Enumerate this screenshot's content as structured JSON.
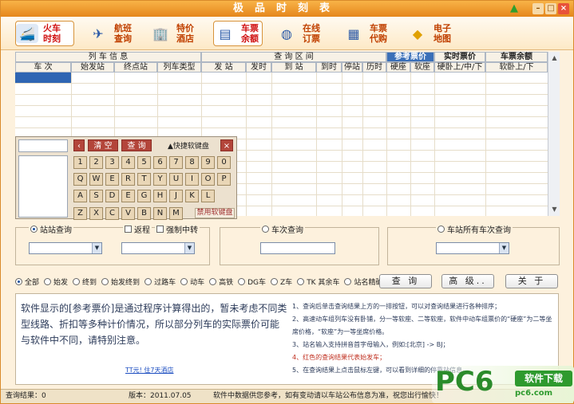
{
  "window": {
    "title": "极品时刻表"
  },
  "toolbar": {
    "items": [
      {
        "label": "火车时刻",
        "icon": "train-icon",
        "active": true
      },
      {
        "label": "航班查询",
        "icon": "airplane-icon",
        "active": false
      },
      {
        "label": "特价酒店",
        "icon": "hotel-icon",
        "active": false
      },
      {
        "label": "车票余额",
        "icon": "ticket-icon",
        "active": true
      },
      {
        "label": "在线订票",
        "icon": "globe-icon",
        "active": false
      },
      {
        "label": "车票代购",
        "icon": "book-icon",
        "active": false
      },
      {
        "label": "电子地图",
        "icon": "map-icon",
        "active": false
      }
    ]
  },
  "table": {
    "group_headers": {
      "train_info": "列 车 信 息",
      "query_interval": "查 询 区 间",
      "ref_price": "参考票价",
      "realtime_price": "实时票价",
      "remaining": "车票余额"
    },
    "columns": [
      "车 次",
      "始发站",
      "终点站",
      "列车类型",
      "发 站",
      "发时",
      "到 站",
      "到时",
      "停站",
      "历时",
      "硬座",
      "软座",
      "硬卧上/中/下",
      "软卧上/下"
    ]
  },
  "keyboard": {
    "clear_label": "清 空",
    "query_label": "查 询",
    "title": "▲快捷软键盘",
    "disable_label": "禁用软键盘",
    "row1": [
      "1",
      "2",
      "3",
      "4",
      "5",
      "6",
      "7",
      "8",
      "9",
      "0"
    ],
    "row2": [
      "Q",
      "W",
      "E",
      "R",
      "T",
      "Y",
      "U",
      "I",
      "O",
      "P"
    ],
    "row3": [
      "A",
      "S",
      "D",
      "E",
      "G",
      "H",
      "J",
      "K",
      "L"
    ],
    "row4": [
      "Z",
      "X",
      "C",
      "V",
      "B",
      "N",
      "M"
    ]
  },
  "search": {
    "station_query": "站站查询",
    "return_trip": "返程",
    "force_transfer": "强制中转",
    "train_query": "车次查询",
    "all_trains": "车站所有车次查询"
  },
  "filters": [
    "全部",
    "始发",
    "终到",
    "始发终到",
    "过路车",
    "动车",
    "高铁",
    "DG车",
    "Z车",
    "TK 其余车",
    "站名精确匹配"
  ],
  "actions": {
    "query": "查 询",
    "advanced": "高 级..",
    "close": "关 于"
  },
  "notice": {
    "main": "软件显示的[参考票价]是通过程序计算得出的，暂未考虑不同类型线路、折扣等多种计价情况，所以部分列车的实际票价可能与软件中不同，请特别注意。",
    "link": "TT元! 住7天酒店",
    "tips": [
      "1、查询后单击查询结果上方的一排按钮，可以对查询结果进行各种排序；",
      "2、高速动车组列车没有卧铺，分一等软座、二等软座，软件中动车组票价的“硬座”为二等坐席价格，“软座”为一等坐席价格。",
      "3、站名输入支持拼音首字母输入，例如:[北京] -> BJ；",
      "4、红色的查询结果代表始发车；",
      "5、在查询结果上点击鼠标左键，可以看到详细的停靠站信息。"
    ]
  },
  "status": {
    "result": "查询结果：0",
    "version": "版本：2011.07.05",
    "disclaimer": "软件中数据供您参考，如有变动请以车站公布信息为准，祝您出行愉快！"
  },
  "watermark": {
    "brand": "PC6",
    "tag": "软件下载",
    "url": "pc6.com"
  },
  "colors": {
    "accent": "#e5861c",
    "header_blue": "#3a6fb8",
    "selection": "#2f65b3",
    "brand_green": "#2e9a2e"
  }
}
